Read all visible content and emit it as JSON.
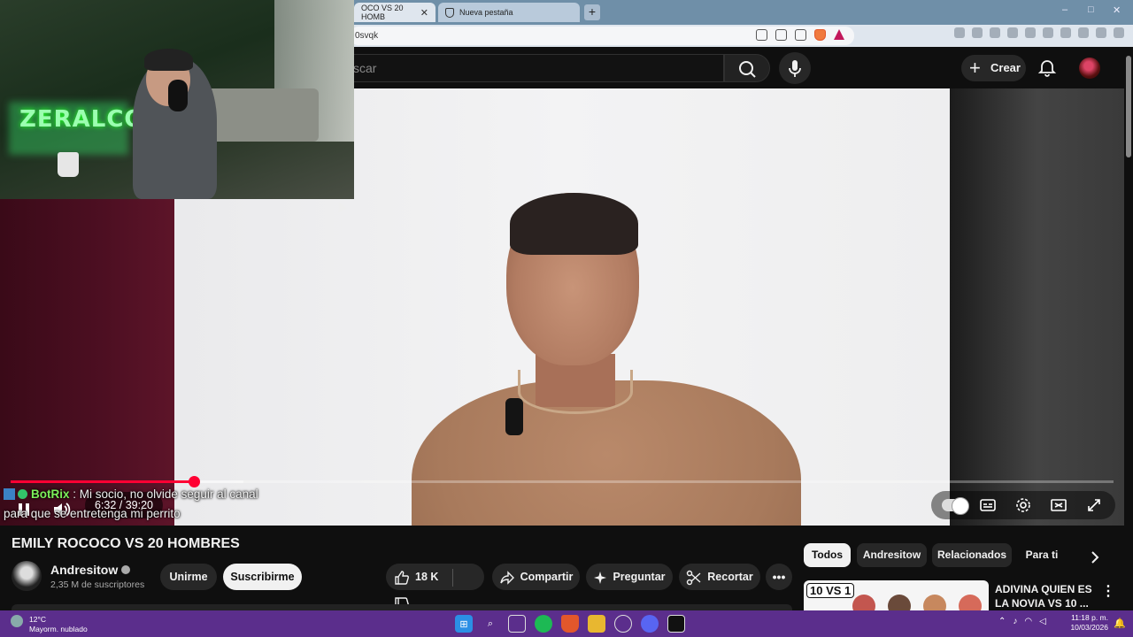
{
  "browser": {
    "tabs": [
      {
        "label": "OCO VS 20 HOMB",
        "active": true
      },
      {
        "label": "Nueva pestaña",
        "active": false
      }
    ],
    "new_tab": "+",
    "address": "0svqk",
    "window_controls": [
      "–",
      "□",
      "✕"
    ]
  },
  "youtube_header": {
    "search_placeholder": "scar",
    "create_label": "Crear"
  },
  "overlay": {
    "streamer_logo": "ZERALCO",
    "chat": {
      "username": "BotRix",
      "separator": ":",
      "message": "Mi socio, no olvide seguir al canal para que se entretenga mi perrito"
    }
  },
  "player": {
    "current_time": "6:32",
    "duration": "39:20",
    "time_display": "6:32 / 39:20",
    "progress_fraction": 0.166,
    "buffered_fraction": 0.211
  },
  "video": {
    "title": "EMILY ROCOCO VS 20 HOMBRES",
    "channel": "Andresitow",
    "subscribers": "2,35 M de suscriptores",
    "join_label": "Unirme",
    "subscribe_label": "Suscribirme",
    "likes": "18 K",
    "share_label": "Compartir",
    "ask_label": "Preguntar",
    "clip_label": "Recortar"
  },
  "sidebar": {
    "chips": [
      {
        "label": "Todos",
        "active": true
      },
      {
        "label": "Andresitow",
        "active": false
      },
      {
        "label": "Relacionados",
        "active": false
      },
      {
        "label": "Para ti",
        "active": false
      }
    ],
    "recommendation": {
      "thumb_badge": "10 VS 1",
      "title": "ADIVINA QUIEN ES LA NOVIA VS 10 ..."
    }
  },
  "taskbar": {
    "temperature": "12°C",
    "weather": "Mayorm. nublado",
    "time": "11:18 p. m.",
    "date": "10/03/2026"
  },
  "colors": {
    "accent_red": "#ff0033",
    "chat_username": "#7cf05a",
    "taskbar": "#5b2e8c"
  }
}
